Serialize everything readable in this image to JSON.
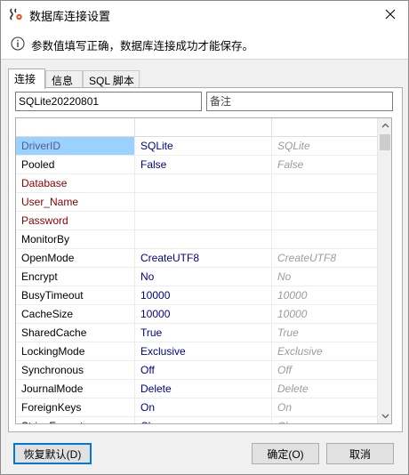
{
  "window": {
    "title": "数据库连接设置",
    "icon": "database-settings-icon"
  },
  "info": {
    "icon": "info-icon",
    "text": "参数值填写正确，数据库连接成功才能保存。"
  },
  "tabs": [
    {
      "label": "连接",
      "active": true
    },
    {
      "label": "信息",
      "active": false
    },
    {
      "label": "SQL 脚本",
      "active": false
    }
  ],
  "connection": {
    "name_value": "SQLite20220801",
    "remark_placeholder": "备注"
  },
  "grid": {
    "rows": [
      {
        "name": "DriverID",
        "value": "SQLite",
        "default": "SQLite",
        "kind": "selected"
      },
      {
        "name": "Pooled",
        "value": "False",
        "default": "False",
        "kind": ""
      },
      {
        "name": "Database",
        "value": "",
        "default": "",
        "kind": "required"
      },
      {
        "name": "User_Name",
        "value": "",
        "default": "",
        "kind": "required"
      },
      {
        "name": "Password",
        "value": "",
        "default": "",
        "kind": "required"
      },
      {
        "name": "MonitorBy",
        "value": "",
        "default": "",
        "kind": ""
      },
      {
        "name": "OpenMode",
        "value": "CreateUTF8",
        "default": "CreateUTF8",
        "kind": ""
      },
      {
        "name": "Encrypt",
        "value": "No",
        "default": "No",
        "kind": ""
      },
      {
        "name": "BusyTimeout",
        "value": "10000",
        "default": "10000",
        "kind": ""
      },
      {
        "name": "CacheSize",
        "value": "10000",
        "default": "10000",
        "kind": ""
      },
      {
        "name": "SharedCache",
        "value": "True",
        "default": "True",
        "kind": ""
      },
      {
        "name": "LockingMode",
        "value": "Exclusive",
        "default": "Exclusive",
        "kind": ""
      },
      {
        "name": "Synchronous",
        "value": "Off",
        "default": "Off",
        "kind": ""
      },
      {
        "name": "JournalMode",
        "value": "Delete",
        "default": "Delete",
        "kind": ""
      },
      {
        "name": "ForeignKeys",
        "value": "On",
        "default": "On",
        "kind": ""
      },
      {
        "name": "StringFormat",
        "value": "Choose",
        "default": "Choose",
        "kind": ""
      }
    ]
  },
  "buttons": {
    "restore_default": "恢复默认(D)",
    "ok": "确定(O)",
    "cancel": "取消"
  },
  "colors": {
    "selection": "#99d1ff",
    "value_text": "#00008b",
    "required_text": "#8b0000",
    "default_text": "#9b9b9b",
    "focus_border": "#0078d7"
  }
}
